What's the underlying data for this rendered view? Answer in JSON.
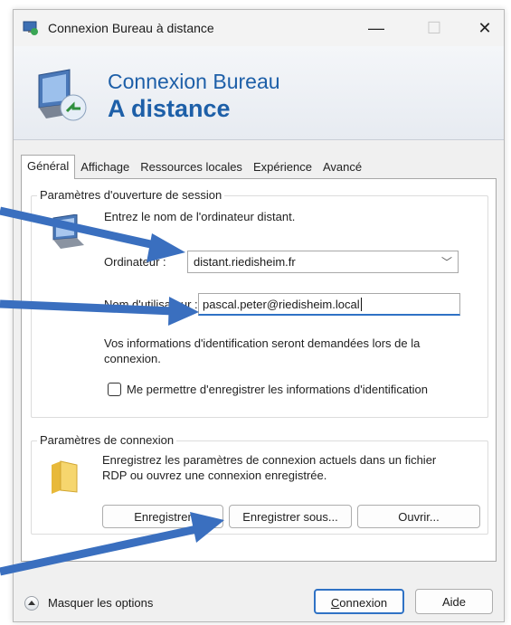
{
  "window": {
    "title": "Connexion Bureau à distance",
    "controls": {
      "minimize": "—",
      "maximize": "☐",
      "close": "✕"
    }
  },
  "banner": {
    "line1": "Connexion Bureau",
    "line2": "A distance"
  },
  "tabs": [
    {
      "label": "Général",
      "active": true
    },
    {
      "label": "Affichage"
    },
    {
      "label": "Ressources locales"
    },
    {
      "label": "Expérience"
    },
    {
      "label": "Avancé"
    }
  ],
  "logon": {
    "legend": "Paramètres d'ouverture de session",
    "instruction": "Entrez le nom de l'ordinateur distant.",
    "computer_label": "Ordinateur :",
    "computer_value": "distant.riedisheim.fr",
    "user_label": "Nom d'utilisateur :",
    "user_value": "pascal.peter@riedisheim.local",
    "info_text": "Vos informations d'identification seront demandées lors de la connexion.",
    "save_creds_label": "Me permettre d'enregistrer les informations d'identification",
    "save_creds_checked": false
  },
  "connection": {
    "legend": "Paramètres de connexion",
    "description": "Enregistrez les paramètres de connexion actuels dans un fichier RDP ou ouvrez une connexion enregistrée.",
    "save_button": "Enregistrer",
    "save_as_button": "Enregistrer sous...",
    "open_button": "Ouvrir..."
  },
  "footer": {
    "hide_options": "Masquer les options",
    "connect_button": "Connexion",
    "help_button": "Aide"
  },
  "colors": {
    "accent": "#2f72c5",
    "banner_text": "#1d5fa8",
    "annotation_arrow": "#3a6fbf"
  }
}
